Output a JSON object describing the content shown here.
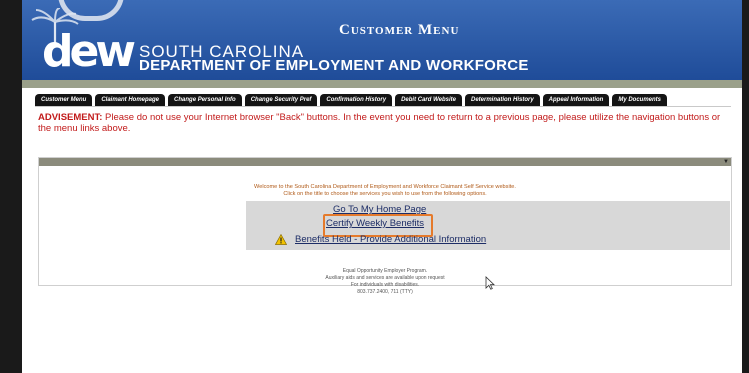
{
  "header": {
    "title": "Customer Menu",
    "logo_text": "dew",
    "org_line1": "SOUTH CAROLINA",
    "org_line2": "DEPARTMENT OF EMPLOYMENT AND WORKFORCE"
  },
  "nav": {
    "tabs": [
      {
        "label": "Customer Menu"
      },
      {
        "label": "Claimant Homepage"
      },
      {
        "label": "Change Personal Info"
      },
      {
        "label": "Change Security Pref"
      },
      {
        "label": "Confirmation History"
      },
      {
        "label": "Debit Card Website"
      },
      {
        "label": "Determination History"
      },
      {
        "label": "Appeal Information"
      },
      {
        "label": "My Documents"
      }
    ]
  },
  "advisement": {
    "label": "ADVISEMENT:",
    "text": " Please do not use your Internet browser \"Back\" buttons. In the event you need to return to a previous page, please utilize the navigation buttons or the menu links above."
  },
  "main": {
    "welcome_line1": "Welcome to the South Carolina Department of Employment and Workforce Claimant Self Service website.",
    "welcome_line2": "Click on the title to choose the services you wish to use from the following options.",
    "links": {
      "home": "Go To My Home Page",
      "certify": "Certify Weekly Benefits",
      "held": "Benefits Held - Provide Additional Information"
    },
    "footer": [
      "Equal Opportunity Employer Program.",
      "Auxiliary aids and services are available upon request",
      "For individuals with disabilities.",
      "803.737.2400, 711 (TTY)"
    ]
  },
  "colors": {
    "header_blue": "#1f4c99",
    "advisement_red": "#c21b1b",
    "highlight_orange": "#e57a2b",
    "link_blue": "#1d2d66"
  },
  "icons": [
    "palmetto-logo-icon",
    "crescent-moon-icon",
    "warning-icon",
    "dropdown-arrow-icon",
    "mouse-cursor-icon"
  ]
}
